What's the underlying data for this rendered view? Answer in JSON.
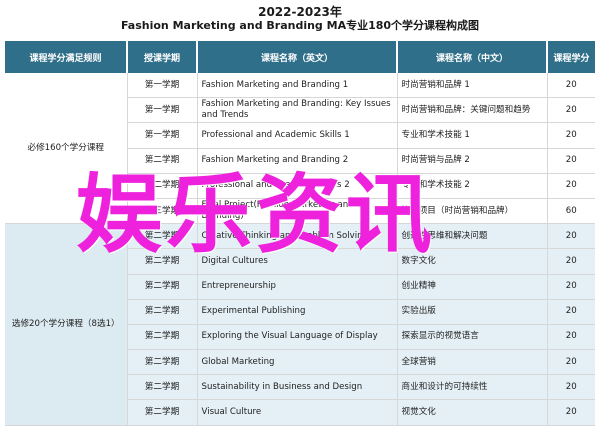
{
  "header": {
    "year": "2022-2023年",
    "subtitle": "Fashion Marketing and Branding MA专业180个学分课程构成图"
  },
  "table": {
    "columns": [
      "课程学分满足规则",
      "授课学期",
      "课程名称（英文）",
      "课程名称（中文）",
      "课程学分"
    ],
    "groups": [
      {
        "label": "必修160个学分课程",
        "type": "required",
        "rows": [
          {
            "semester": "第一学期",
            "en": "Fashion Marketing and Branding 1",
            "zh": "时尚营销和品牌 1",
            "credits": "20"
          },
          {
            "semester": "第一学期",
            "en": "Fashion Marketing and Branding: Key Issues and Trends",
            "zh": "时尚营销和品牌：关键问题和趋势",
            "credits": "20"
          },
          {
            "semester": "第一学期",
            "en": "Professional and Academic Skills 1",
            "zh": "专业和学术技能 1",
            "credits": "20"
          },
          {
            "semester": "第二学期",
            "en": "Fashion Marketing and Branding 2",
            "zh": "时尚营销与品牌 2",
            "credits": "20"
          },
          {
            "semester": "第二学期",
            "en": "Professional and Academic Skills 2",
            "zh": "专业和学术技能 2",
            "credits": "20"
          },
          {
            "semester": "第三学期",
            "en": "Final Project(Fashion Marketing and Branding)",
            "zh": "毕业项目（时尚营销和品牌）",
            "credits": "60"
          }
        ]
      },
      {
        "label": "选修20个学分课程（8选1）",
        "type": "elective",
        "rows": [
          {
            "semester": "第二学期",
            "en": "Creative Thinking and Problem Solving",
            "zh": "创造性思维和解决问题",
            "credits": "20"
          },
          {
            "semester": "第二学期",
            "en": "Digital Cultures",
            "zh": "数字文化",
            "credits": "20"
          },
          {
            "semester": "第二学期",
            "en": "Entrepreneurship",
            "zh": "创业精神",
            "credits": "20"
          },
          {
            "semester": "第二学期",
            "en": "Experimental Publishing",
            "zh": "实验出版",
            "credits": "20"
          },
          {
            "semester": "第二学期",
            "en": "Exploring the Visual Language of Display",
            "zh": "探索显示的视觉语言",
            "credits": "20"
          },
          {
            "semester": "第二学期",
            "en": "Global Marketing",
            "zh": "全球营销",
            "credits": "20"
          },
          {
            "semester": "第二学期",
            "en": "Sustainability in Business and Design",
            "zh": "商业和设计的可持续性",
            "credits": "20"
          },
          {
            "semester": "第二学期",
            "en": "Visual Culture",
            "zh": "视觉文化",
            "credits": "20"
          }
        ]
      }
    ]
  },
  "watermark": {
    "text": "娱乐资讯",
    "color": "#ee22dd"
  },
  "colors": {
    "header_bg": "#2f6f8a",
    "elective_bg": "#e4f0f6"
  }
}
